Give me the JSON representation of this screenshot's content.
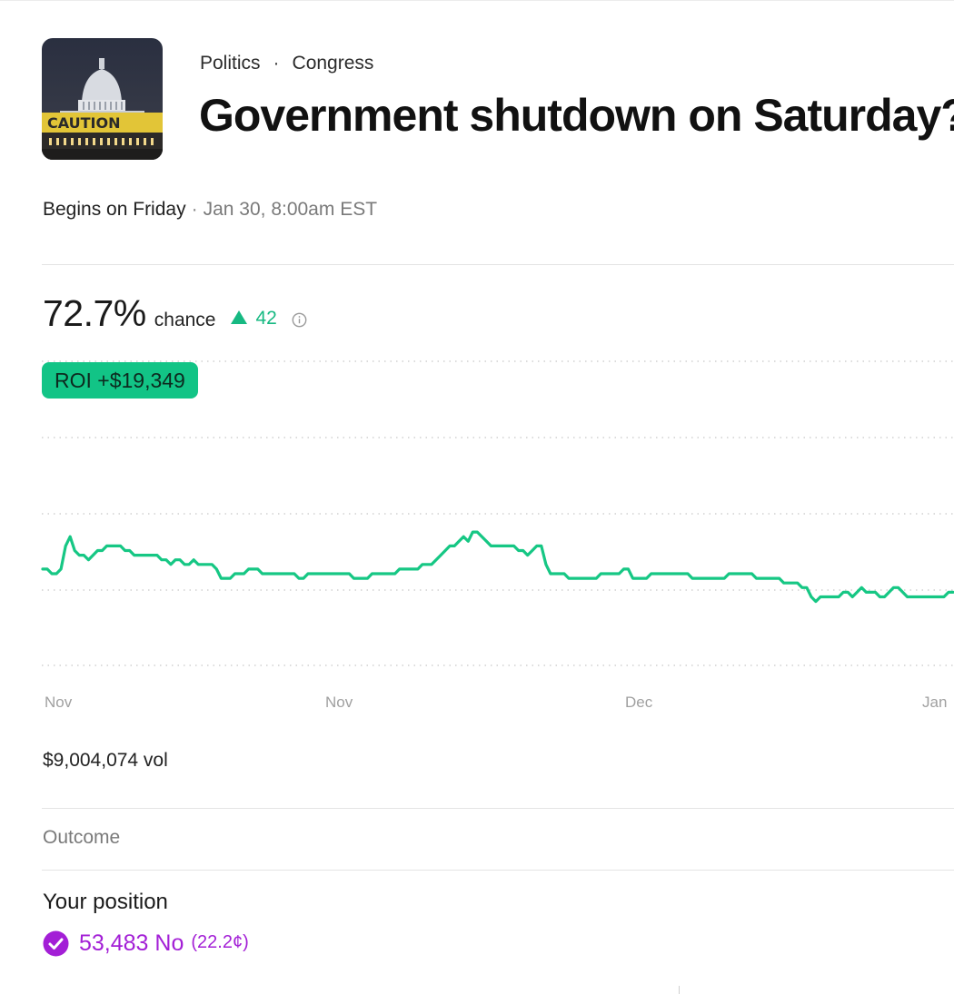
{
  "market": {
    "category": "Politics",
    "subcategory": "Congress",
    "title": "Government shutdown on Saturday?",
    "thumbnail_text": "CAUTION",
    "begins_label": "Begins on Friday",
    "date": "Jan 30, 8:00am EST"
  },
  "odds": {
    "chance_value": "72.7%",
    "chance_label": "chance",
    "delta": "42",
    "delta_icon": "triangle-up-icon",
    "info_icon": "info-icon",
    "accent_color": "#16b982"
  },
  "roi_badge": "ROI +$19,349",
  "chart_data": {
    "type": "line",
    "title": "",
    "xlabel": "",
    "ylabel": "",
    "x_tick_labels": [
      "Nov",
      "Nov",
      "Dec",
      "Jan"
    ],
    "grid": true,
    "series": [
      {
        "color": "#16c784",
        "values": [
          61,
          61,
          60,
          60,
          61,
          66,
          68,
          65,
          64,
          64,
          63,
          64,
          65,
          65,
          66,
          66,
          66,
          66,
          65,
          65,
          64,
          64,
          64,
          64,
          64,
          64,
          63,
          63,
          62,
          63,
          63,
          62,
          62,
          63,
          62,
          62,
          62,
          62,
          61,
          59,
          59,
          59,
          60,
          60,
          60,
          61,
          61,
          61,
          60,
          60,
          60,
          60,
          60,
          60,
          60,
          60,
          59,
          59,
          60,
          60,
          60,
          60,
          60,
          60,
          60,
          60,
          60,
          60,
          59,
          59,
          59,
          59,
          60,
          60,
          60,
          60,
          60,
          60,
          61,
          61,
          61,
          61,
          61,
          62,
          62,
          62,
          63,
          64,
          65,
          66,
          66,
          67,
          68,
          67,
          69,
          69,
          68,
          67,
          66,
          66,
          66,
          66,
          66,
          66,
          65,
          65,
          64,
          65,
          66,
          66,
          62,
          60,
          60,
          60,
          60,
          59,
          59,
          59,
          59,
          59,
          59,
          59,
          60,
          60,
          60,
          60,
          60,
          61,
          61,
          59,
          59,
          59,
          59,
          60,
          60,
          60,
          60,
          60,
          60,
          60,
          60,
          60,
          59,
          59,
          59,
          59,
          59,
          59,
          59,
          59,
          60,
          60,
          60,
          60,
          60,
          60,
          59,
          59,
          59,
          59,
          59,
          59,
          58,
          58,
          58,
          58,
          57,
          57,
          55,
          54,
          55,
          55,
          55,
          55,
          55,
          56,
          56,
          55,
          56,
          57,
          56,
          56,
          56,
          55,
          55,
          56,
          57,
          57,
          56,
          55,
          55,
          55,
          55,
          55,
          55,
          55,
          55,
          55,
          56,
          56
        ]
      }
    ]
  },
  "volume": "$9,004,074 vol",
  "outcome_header": "Outcome",
  "position": {
    "title": "Your position",
    "shares": "53,483 No",
    "price": "(22.2¢)",
    "check_icon": "check-circle-icon",
    "color": "#a31fd6"
  }
}
